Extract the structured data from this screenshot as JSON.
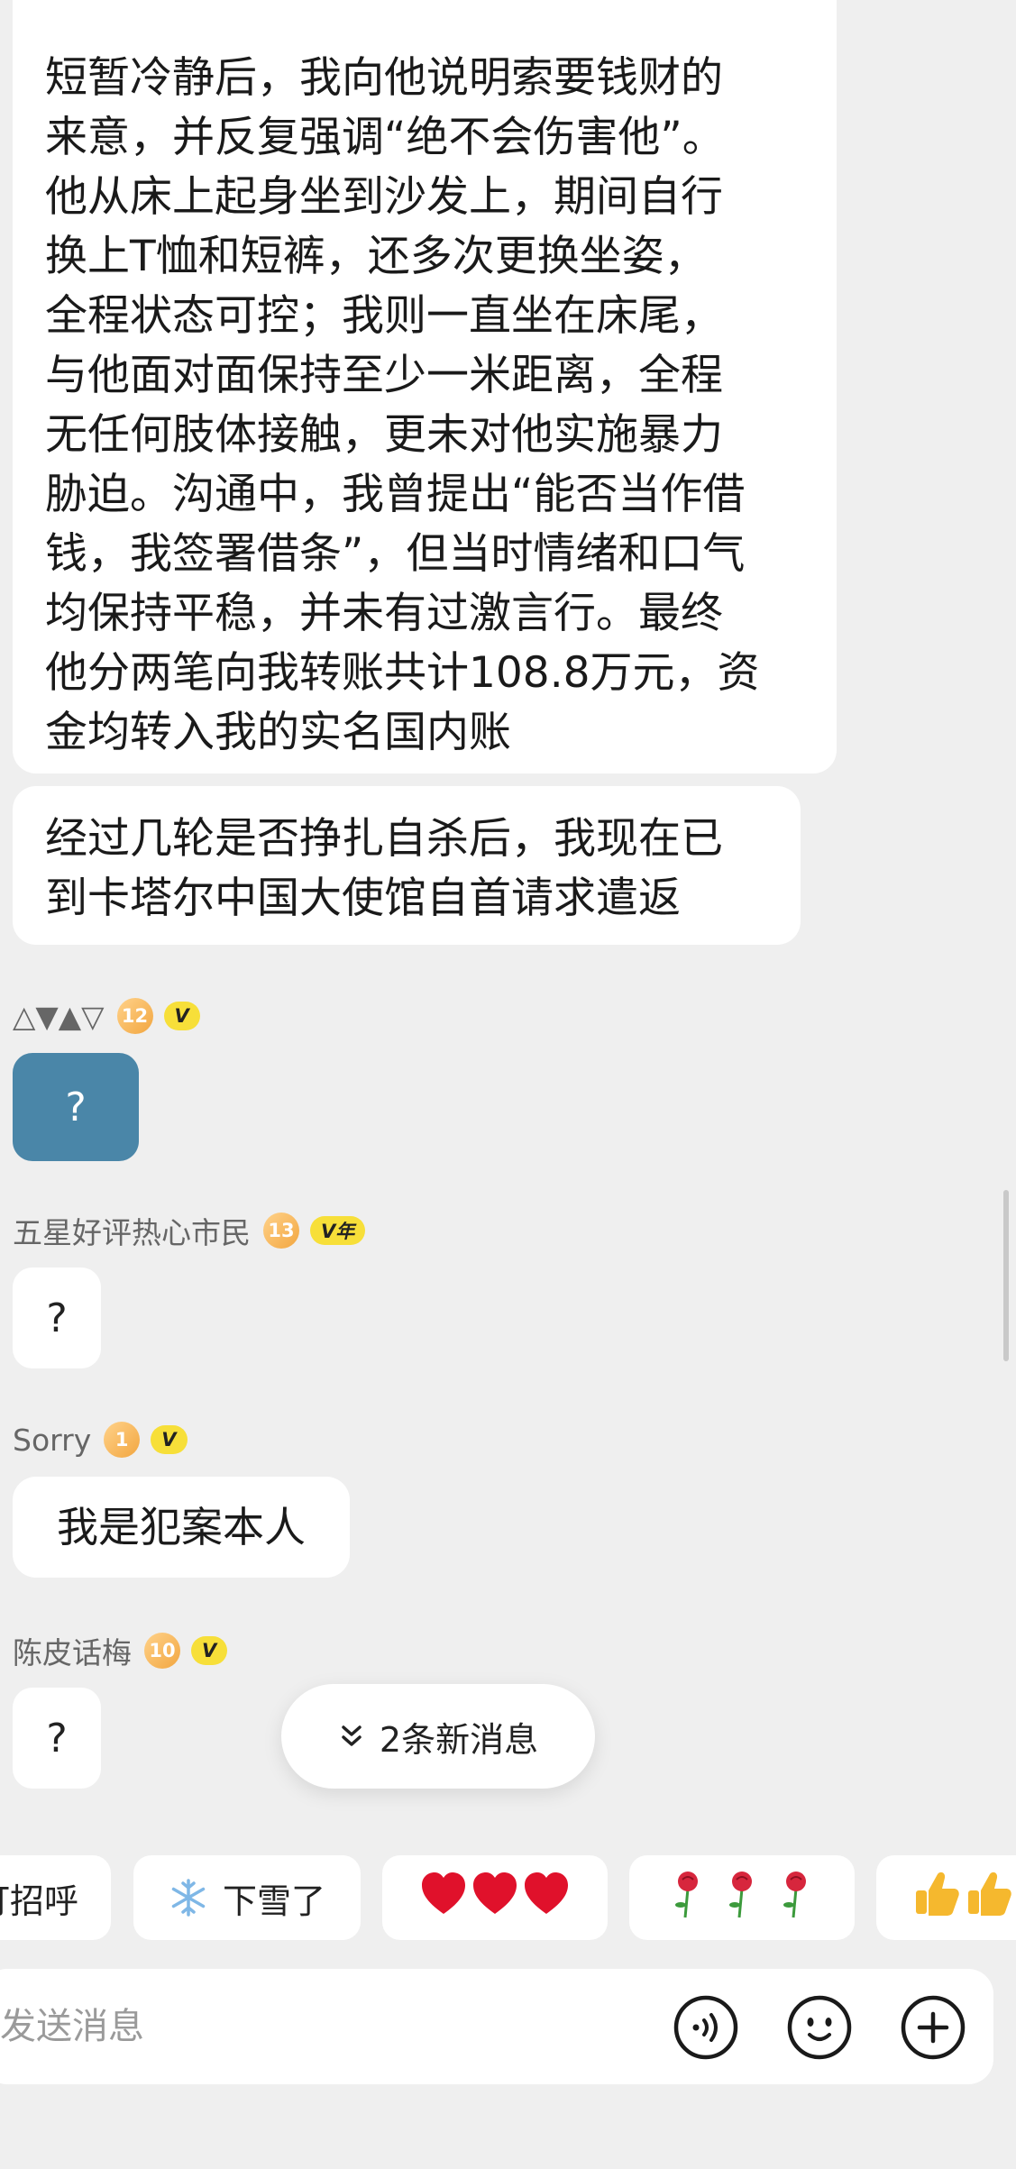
{
  "messages": {
    "long_text": "短暂冷静后，我向他说明索要钱财的\n来意，并反复强调“绝不会伤害他”。\n他从床上起身坐到沙发上，期间自行\n换上T恤和短裤，还多次更换坐姿，\n全程状态可控；我则一直坐在床尾，\n与他面对面保持至少一米距离，全程\n无任何肢体接触，更未对他实施暴力\n胁迫。沟通中，我曾提出“能否当作借\n钱，我签署借条”，但当时情绪和口气\n均保持平稳，并未有过激言行。最终\n他分两笔向我转账共计108.8万元，资\n金均转入我的实名国内账",
    "second_text": "经过几轮是否挣扎自杀后，我现在已\n到卡塔尔中国大使馆自首请求遣返",
    "users": [
      {
        "name": "△▼▲▽",
        "level": "12",
        "vip": "V",
        "reply": "?"
      },
      {
        "name": "五星好评热心市民",
        "level": "13",
        "vip": "V年",
        "reply": "?"
      },
      {
        "name": "Sorry",
        "level": "1",
        "vip": "V",
        "reply": "我是犯案本人"
      },
      {
        "name": "陈皮话梅",
        "level": "10",
        "vip": "V",
        "reply": "?"
      }
    ]
  },
  "new_messages_pill": {
    "icon": "double-chevron-down-icon",
    "label": "2条新消息"
  },
  "quick_replies": {
    "greet": "打招呼",
    "snow": "下雪了",
    "snow_icon": "snowflake-icon",
    "hearts_icon": "three-hearts-icon",
    "roses_icon": "three-roses-icon",
    "thumbs_icon": "thumbs-up-icon"
  },
  "input": {
    "placeholder": "发送消息"
  },
  "buttons": {
    "voice_icon": "voice-icon",
    "emoji_icon": "emoji-icon",
    "plus_icon": "plus-icon"
  },
  "colors": {
    "background": "#efefef",
    "bubble": "#ffffff",
    "selected_bubble": "#4a86a8",
    "vip": "#f7df39",
    "level": "#f2a640",
    "heart": "#e0112b"
  }
}
